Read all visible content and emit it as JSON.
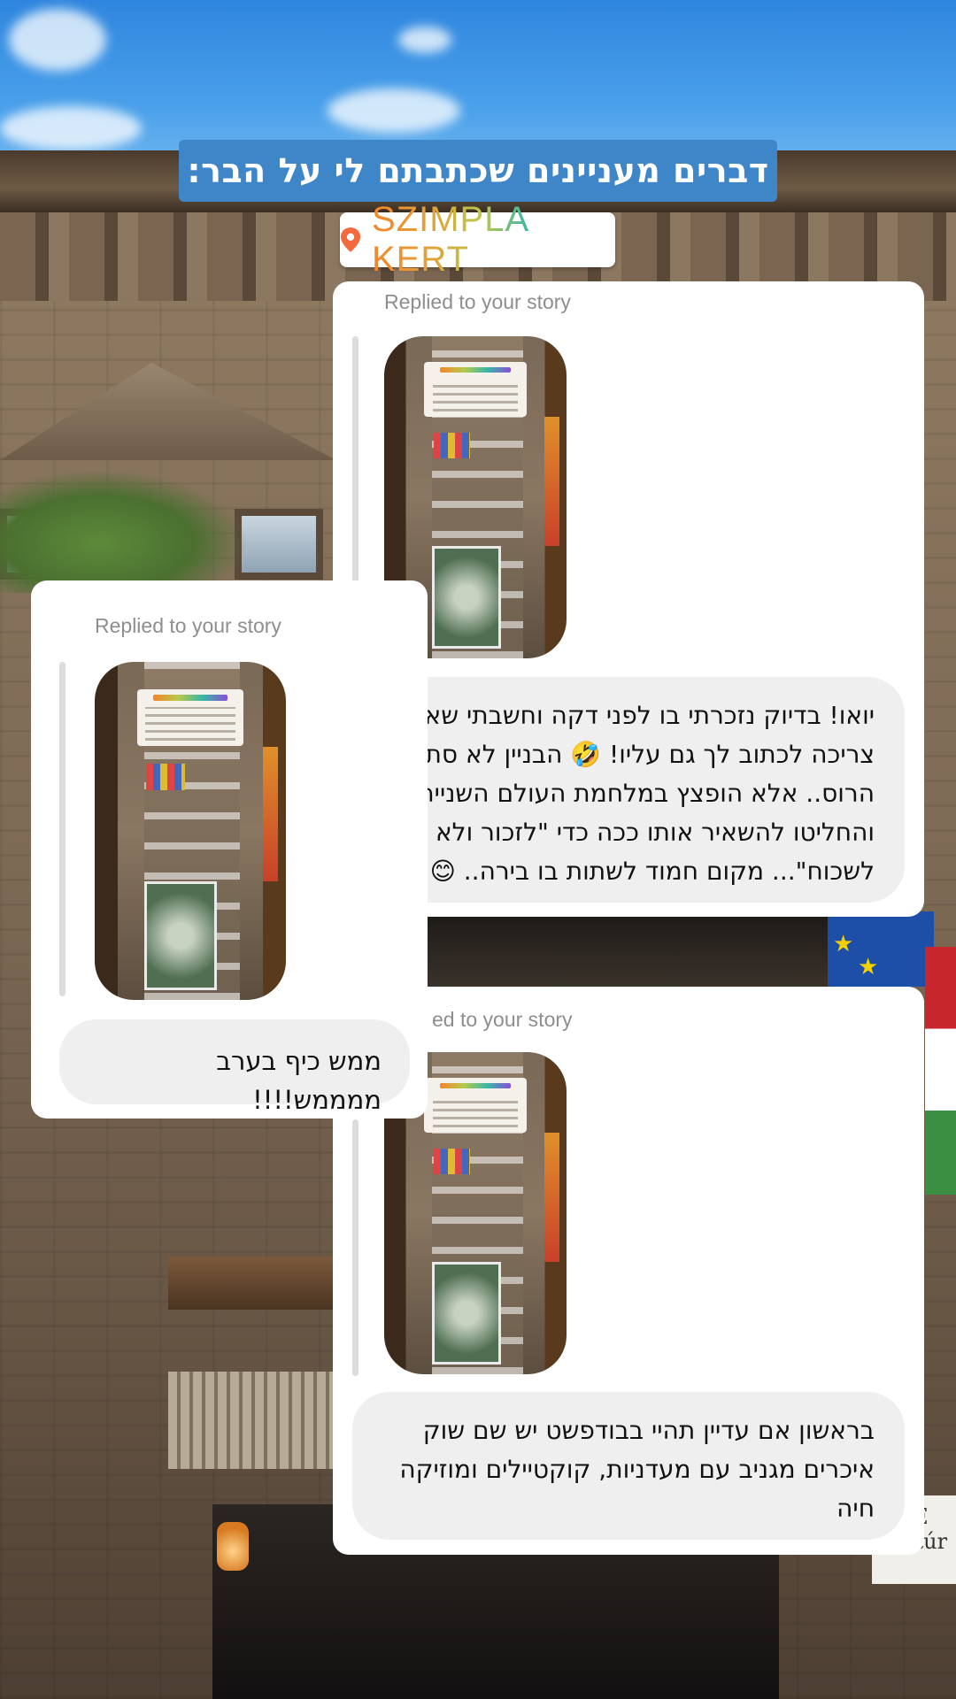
{
  "story": {
    "header_text": "דברים מעניינים שכתבתם לי על הבר:",
    "location_sticker": {
      "icon": "location-pin-icon",
      "text": "SZIMPLA KERT"
    }
  },
  "replies": [
    {
      "label": "Replied to your story",
      "message": "יואו! בדיוק נזכרתי בו לפני דקה וחשבתי שאני צריכה לכתוב לך גם עליו! 🤣 הבניין לא סתם הרוס.. אלא הופצץ במלחמת העולם השנייה, והחליטו להשאיר אותו ככה כדי \"לזכור ולא לשכוח\"... מקום חמוד לשתות בו בירה.. 😊"
    },
    {
      "label": "Replied to your story",
      "message": "ממש כיף בערב ממממש!!!!"
    },
    {
      "label": "ed to your story",
      "message": "בראשון אם עדיין תהיי בבודפשט יש שם שוק איכרים מגניב עם מעדניות, קוקטיילים ומוזיקה חיה"
    }
  ],
  "background_sign": "er. E\nKultúr"
}
